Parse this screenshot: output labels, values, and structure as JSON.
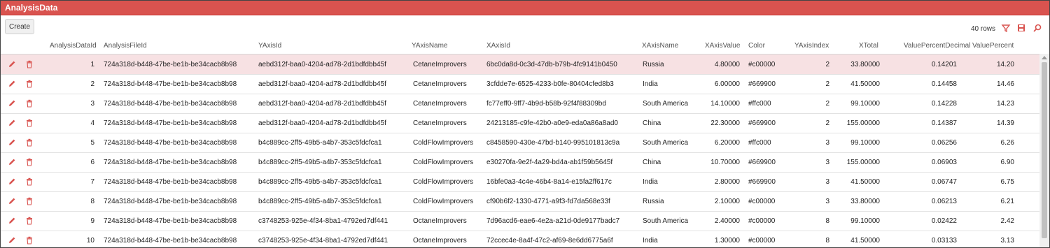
{
  "window": {
    "title": "AnalysisData"
  },
  "toolbar": {
    "create_label": "Create",
    "row_count": "40 rows",
    "icons": [
      "filter-icon",
      "export-icon",
      "search-icon"
    ],
    "accent": "#d9534f"
  },
  "columns": [
    "AnalysisDataId",
    "AnalysisFileId",
    "YAxisId",
    "YAxisName",
    "XAxisId",
    "XAxisName",
    "XAxisValue",
    "Color",
    "YAxisIndex",
    "XTotal",
    "ValuePercentDecimal",
    "ValuePercent"
  ],
  "rows": [
    [
      "1",
      "724a318d-b448-47be-be1b-be34cacb8b98",
      "aebd312f-baa0-4204-ad78-2d1bdfdbb45f",
      "CetaneImprovers",
      "6bc0da8d-0c3d-47db-b79b-4fc9141b0450",
      "Russia",
      "4.80000",
      "#c00000",
      "2",
      "33.80000",
      "0.14201",
      "14.20"
    ],
    [
      "2",
      "724a318d-b448-47be-be1b-be34cacb8b98",
      "aebd312f-baa0-4204-ad78-2d1bdfdbb45f",
      "CetaneImprovers",
      "3cfdde7e-6525-4233-b0fe-80404cfed8b3",
      "India",
      "6.00000",
      "#669900",
      "2",
      "41.50000",
      "0.14458",
      "14.46"
    ],
    [
      "3",
      "724a318d-b448-47be-be1b-be34cacb8b98",
      "aebd312f-baa0-4204-ad78-2d1bdfdbb45f",
      "CetaneImprovers",
      "fc77eff0-9ff7-4b9d-b58b-92f4f88309bd",
      "South America",
      "14.10000",
      "#ffc000",
      "2",
      "99.10000",
      "0.14228",
      "14.23"
    ],
    [
      "4",
      "724a318d-b448-47be-be1b-be34cacb8b98",
      "aebd312f-baa0-4204-ad78-2d1bdfdbb45f",
      "CetaneImprovers",
      "24213185-c9fe-42b0-a0e9-eda0a86a8ad0",
      "China",
      "22.30000",
      "#669900",
      "2",
      "155.00000",
      "0.14387",
      "14.39"
    ],
    [
      "5",
      "724a318d-b448-47be-be1b-be34cacb8b98",
      "b4c889cc-2ff5-49b5-a4b7-353c5fdcfca1",
      "ColdFlowImprovers",
      "c8458590-430e-47bd-b140-995101813c9a",
      "South America",
      "6.20000",
      "#ffc000",
      "3",
      "99.10000",
      "0.06256",
      "6.26"
    ],
    [
      "6",
      "724a318d-b448-47be-be1b-be34cacb8b98",
      "b4c889cc-2ff5-49b5-a4b7-353c5fdcfca1",
      "ColdFlowImprovers",
      "e30270fa-9e2f-4a29-bd4a-ab1f59b5645f",
      "China",
      "10.70000",
      "#669900",
      "3",
      "155.00000",
      "0.06903",
      "6.90"
    ],
    [
      "7",
      "724a318d-b448-47be-be1b-be34cacb8b98",
      "b4c889cc-2ff5-49b5-a4b7-353c5fdcfca1",
      "ColdFlowImprovers",
      "16bfe0a3-4c4e-46b4-8a14-e15fa2ff617c",
      "India",
      "2.80000",
      "#669900",
      "3",
      "41.50000",
      "0.06747",
      "6.75"
    ],
    [
      "8",
      "724a318d-b448-47be-be1b-be34cacb8b98",
      "b4c889cc-2ff5-49b5-a4b7-353c5fdcfca1",
      "ColdFlowImprovers",
      "cf90b6f2-1330-4771-a9f3-fd7da568e33f",
      "Russia",
      "2.10000",
      "#c00000",
      "3",
      "33.80000",
      "0.06213",
      "6.21"
    ],
    [
      "9",
      "724a318d-b448-47be-be1b-be34cacb8b98",
      "c3748253-925e-4f34-8ba1-4792ed7df441",
      "OctaneImprovers",
      "7d96acd6-eae6-4e2a-a21d-0de9177badc7",
      "South America",
      "2.40000",
      "#c00000",
      "8",
      "99.10000",
      "0.02422",
      "2.42"
    ],
    [
      "10",
      "724a318d-b448-47be-be1b-be34cacb8b98",
      "c3748253-925e-4f34-8ba1-4792ed7df441",
      "OctaneImprovers",
      "72ccec4e-8a4f-47c2-af69-8e6dd6775a6f",
      "India",
      "1.30000",
      "#c00000",
      "8",
      "41.50000",
      "0.03133",
      "3.13"
    ]
  ]
}
